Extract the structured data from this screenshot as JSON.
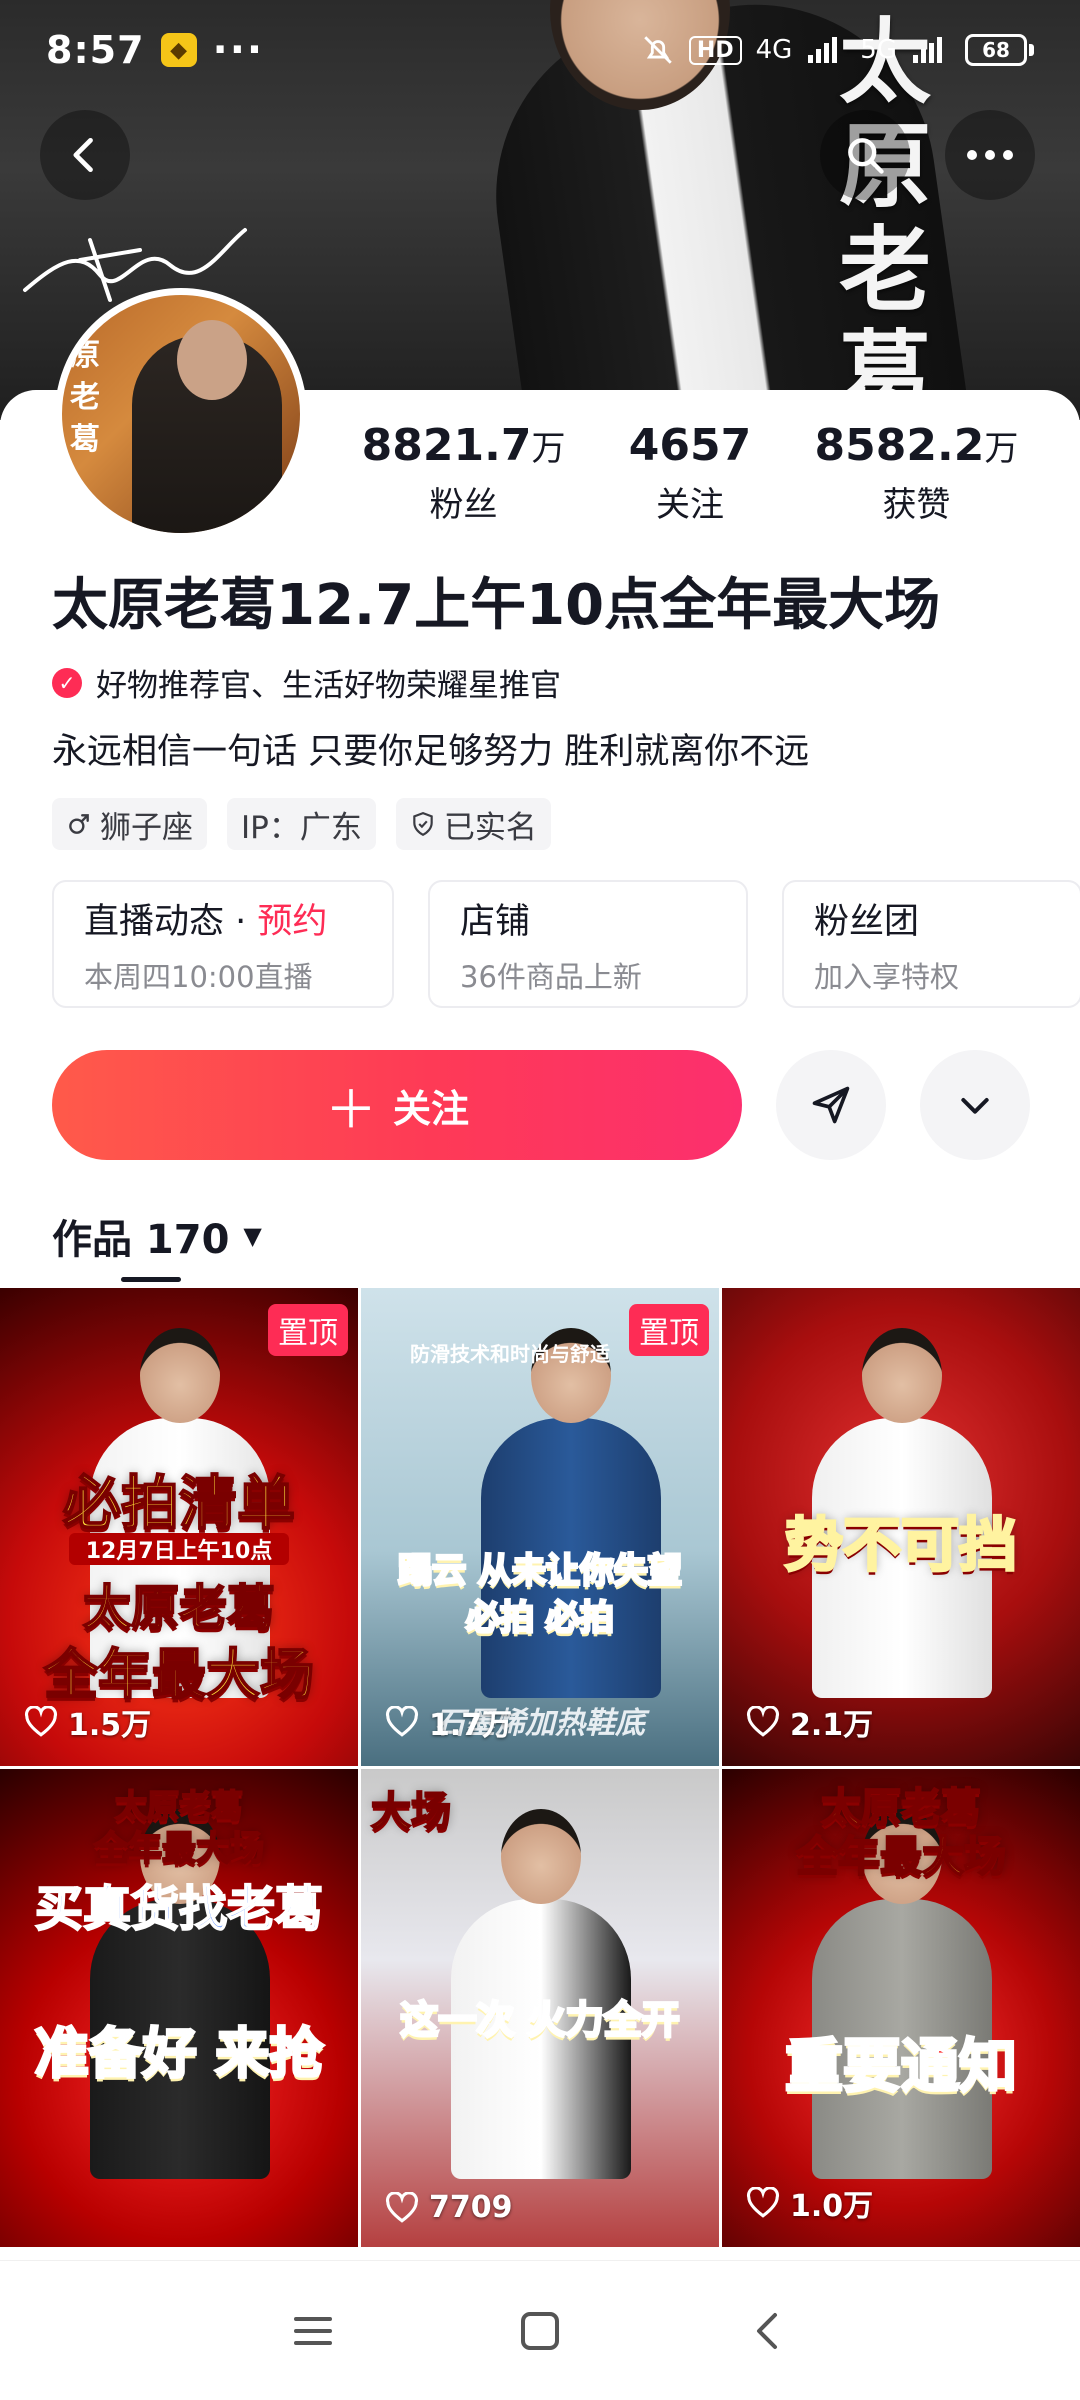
{
  "status_bar": {
    "time": "8:57",
    "dots": "···",
    "hd": "HD",
    "network": "4G",
    "network2": "5G",
    "battery": "68"
  },
  "banner": {
    "title_chars": [
      "太",
      "原",
      "老",
      "葛"
    ]
  },
  "avatar": {
    "text_chars": [
      "原",
      "老",
      "葛"
    ]
  },
  "stats": [
    {
      "value": "8821.7",
      "unit": "万",
      "label": "粉丝"
    },
    {
      "value": "4657",
      "unit": "",
      "label": "关注"
    },
    {
      "value": "8582.2",
      "unit": "万",
      "label": "获赞"
    }
  ],
  "profile": {
    "nickname": "太原老葛12.7上午10点全年最大场",
    "verification": "好物推荐官、生活好物荣耀星推官",
    "bio": "永远相信一句话 只要你足够努力 胜利就离你不远"
  },
  "tags": [
    {
      "icon": "male-icon",
      "label": "狮子座"
    },
    {
      "icon": "",
      "label": "IP：广东"
    },
    {
      "icon": "shield-icon",
      "label": "已实名"
    }
  ],
  "info_cards": [
    {
      "title": "直播动态",
      "sep": " · ",
      "highlight": "预约",
      "subtitle": "本周四10:00直播"
    },
    {
      "title": "店铺",
      "subtitle": "36件商品上新"
    },
    {
      "title": "粉丝团",
      "subtitle": "加入享特权"
    }
  ],
  "actions": {
    "follow_label": "关注"
  },
  "works": {
    "label": "作品 170"
  },
  "videos": [
    {
      "pinned": "置顶",
      "title_lines": [
        "必拍清单",
        "12月7日上午10点",
        "太原老葛",
        "全年最大场"
      ],
      "likes": "1.5万",
      "theme": "red"
    },
    {
      "pinned": "置顶",
      "title_lines": [
        "防滑技术和时尚与舒适",
        "蹋云 从未让你失望",
        "必拍 必拍",
        "石墨烯加热鞋底"
      ],
      "likes": "1.7万",
      "theme": "blue"
    },
    {
      "pinned": "",
      "title_lines": [
        "势不可挡"
      ],
      "likes": "2.1万",
      "theme": "stage"
    },
    {
      "pinned": "",
      "title_lines": [
        "太原老葛",
        "全年最大场",
        "买真货找老葛",
        "准备好 来抢"
      ],
      "likes": "",
      "theme": "red2"
    },
    {
      "pinned": "",
      "title_lines": [
        "大场",
        "这一次 火力全开"
      ],
      "likes": "7709",
      "theme": "warehouse"
    },
    {
      "pinned": "",
      "title_lines": [
        "太原老葛",
        "全年最大场",
        "重要通知"
      ],
      "likes": "1.0万",
      "theme": "red3"
    }
  ],
  "colors": {
    "accent": "#fe2c55",
    "follow_gradient_start": "#ff5a4a",
    "follow_gradient_end": "#fc2f6e"
  }
}
